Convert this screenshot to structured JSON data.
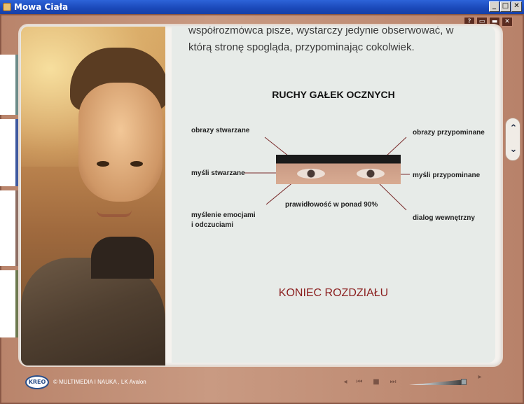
{
  "window": {
    "title": "Mowa Ciała",
    "buttons": [
      "_",
      "□",
      "✕"
    ]
  },
  "top_buttons": [
    "?",
    "▭",
    "▬",
    "✕"
  ],
  "content": {
    "intro_lines": [
      "współrozmówca pisze, wystarczy jedynie obserwować, w",
      "którą stronę spogląda, przypominając cokolwiek."
    ],
    "diagram": {
      "title": "RUCHY GAŁEK OCZNYCH",
      "labels": {
        "top_left": "obrazy stwarzane",
        "middle_left": "myśli stwarzane",
        "bottom_left_1": "myślenie emocjami",
        "bottom_left_2": "i odczuciami",
        "top_right": "obrazy przypominane",
        "middle_right": "myśli przypominane",
        "bottom_right": "dialog wewnętrzny",
        "bottom_center": "prawidłowość w ponad 90%"
      }
    },
    "end_chapter": "KONIEC ROZDZIAŁU"
  },
  "nav": {
    "up_icon": "double-chevron-up-icon",
    "down_icon": "double-chevron-down-icon",
    "up_glyph": "⌃",
    "down_glyph": "⌄"
  },
  "footer": {
    "logo": "KREO",
    "copyright": "© MULTIMEDIA I NAUKA , LK Avalon",
    "controls": [
      "◂",
      "⏮",
      "■",
      "⏭",
      "▸"
    ]
  },
  "colors": {
    "frame": "#c99a82",
    "end_chapter": "#8b1f1f",
    "titlebar": "#1a48b8"
  }
}
